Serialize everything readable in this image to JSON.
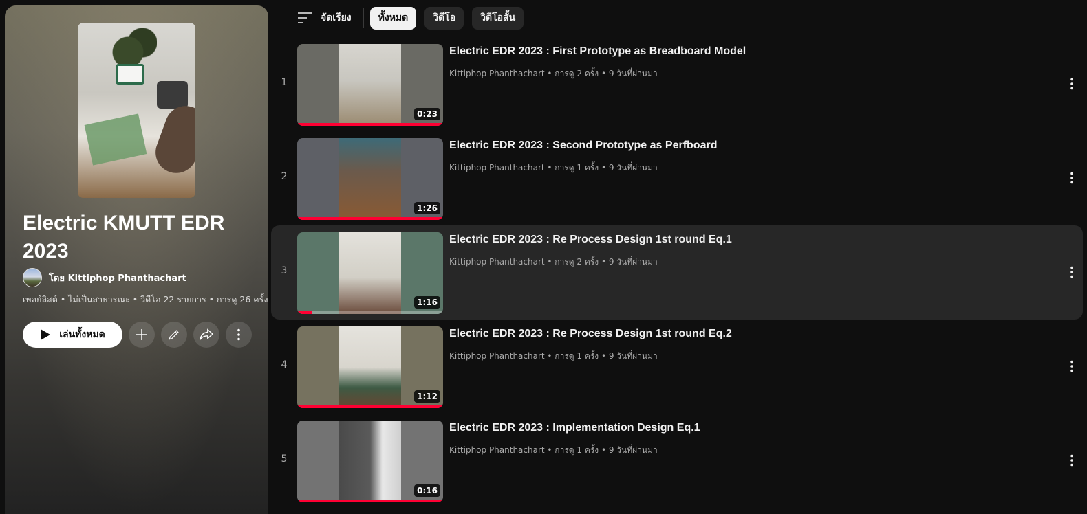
{
  "filters": {
    "sort_label": "จัดเรียง",
    "chips": [
      "ทั้งหมด",
      "วิดีโอ",
      "วิดีโอสั้น"
    ],
    "active_chip": "ทั้งหมด"
  },
  "playlist": {
    "title": "Electric KMUTT EDR 2023",
    "owner": "โดย Kittiphop Phanthachart",
    "meta": "เพลย์ลิสต์ • ไม่เป็นสาธารณะ • วิดีโอ 22 รายการ • การดู 26 ครั้ง",
    "play_all_label": "เล่นทั้งหมด"
  },
  "videos": [
    {
      "index": "1",
      "title": "Electric EDR 2023 : First Prototype as Breadboard Model",
      "meta": "Kittiphop Phanthachart • การดู 2 ครั้ง • 9 วันที่ผ่านมา",
      "duration": "0:23",
      "watched_fraction": 1.0
    },
    {
      "index": "2",
      "title": "Electric EDR 2023 : Second Prototype as Perfboard",
      "meta": "Kittiphop Phanthachart • การดู 1 ครั้ง • 9 วันที่ผ่านมา",
      "duration": "1:26",
      "watched_fraction": 1.0
    },
    {
      "index": "3",
      "title": "Electric EDR 2023 : Re Process Design 1st round Eq.1",
      "meta": "Kittiphop Phanthachart • การดู 2 ครั้ง • 9 วันที่ผ่านมา",
      "duration": "1:16",
      "watched_fraction": 0.1
    },
    {
      "index": "4",
      "title": "Electric EDR 2023 : Re Process Design 1st round Eq.2",
      "meta": "Kittiphop Phanthachart • การดู 1 ครั้ง • 9 วันที่ผ่านมา",
      "duration": "1:12",
      "watched_fraction": 1.0
    },
    {
      "index": "5",
      "title": "Electric EDR 2023 : Implementation Design Eq.1",
      "meta": "Kittiphop Phanthachart • การดู 1 ครั้ง • 9 วันที่ผ่านมา",
      "duration": "0:16",
      "watched_fraction": 1.0
    }
  ],
  "colors": {
    "progress": "#ff0033",
    "background": "#0f0f0f",
    "chip_active": "#f1f1f1"
  },
  "icons": {
    "sort": "sort-icon",
    "edit_cover": "pencil-icon",
    "play": "play-icon",
    "add": "plus-icon",
    "edit": "pencil-icon",
    "share": "share-icon",
    "more": "more-vert-icon"
  }
}
